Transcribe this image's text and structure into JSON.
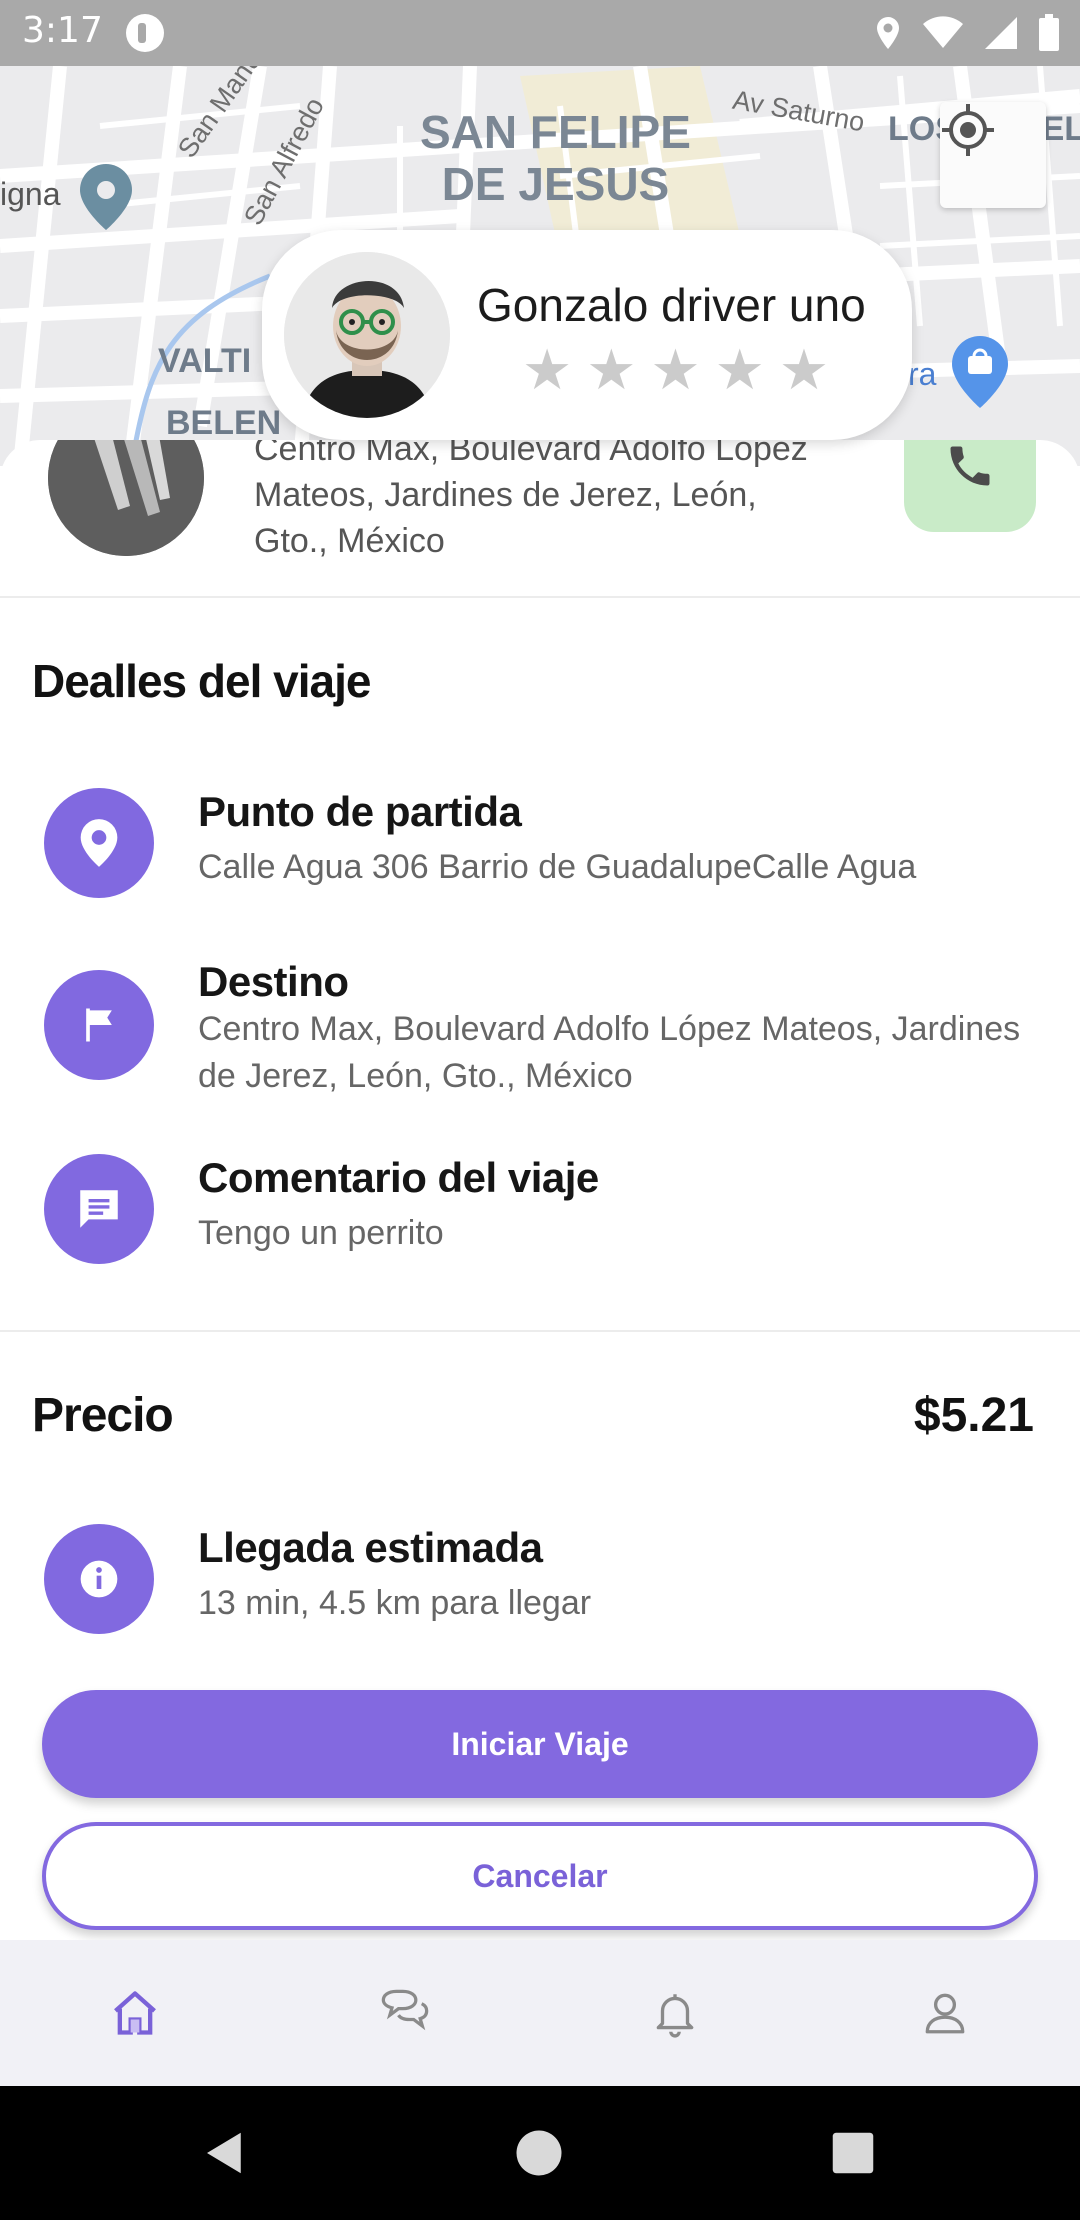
{
  "status_bar": {
    "time": "3:17"
  },
  "map": {
    "district": "SAN FELIPE\nDE JESUS",
    "streets": {
      "san_manuel": "San Manuel",
      "san_alfredo": "San Alfredo",
      "av_saturno": "Av Saturno"
    },
    "areas": {
      "los_angeles": "LOS ANGEL",
      "valtierra": "VALTI",
      "belen": "BELEN",
      "left_place": "igna",
      "right_place": "ra"
    }
  },
  "driver": {
    "name": "Gonzalo driver uno",
    "rating_stars": 5,
    "rating_filled": 0,
    "star_glyph": "★"
  },
  "pickup": {
    "address": "Centro Max, Boulevard Adolfo López Mateos, Jardines de Jerez, León, Gto., México"
  },
  "details": {
    "title": "Dealles del viaje",
    "start_label": "Punto de partida",
    "start_value": "Calle Agua 306 Barrio de GuadalupeCalle Agua",
    "destination_label": "Destino",
    "destination_value": "Centro Max, Boulevard Adolfo López Mateos, Jardines de Jerez, León, Gto., México",
    "comment_label": "Comentario del viaje",
    "comment_value": "Tengo un perrito"
  },
  "price": {
    "label": "Precio",
    "value": "$5.21"
  },
  "eta": {
    "label": "Llegada estimada",
    "value": "13 min, 4.5 km  para llegar"
  },
  "actions": {
    "start": "Iniciar Viaje",
    "cancel": "Cancelar"
  },
  "nav": {
    "items": [
      "home-icon",
      "chat-icon",
      "bell-icon",
      "profile-icon"
    ],
    "active": "home-icon"
  },
  "colors": {
    "accent": "#8369e0",
    "call_bg": "#c9ebc8",
    "nav_active": "#7a62d8",
    "nav_inactive": "#8a8a8a"
  }
}
